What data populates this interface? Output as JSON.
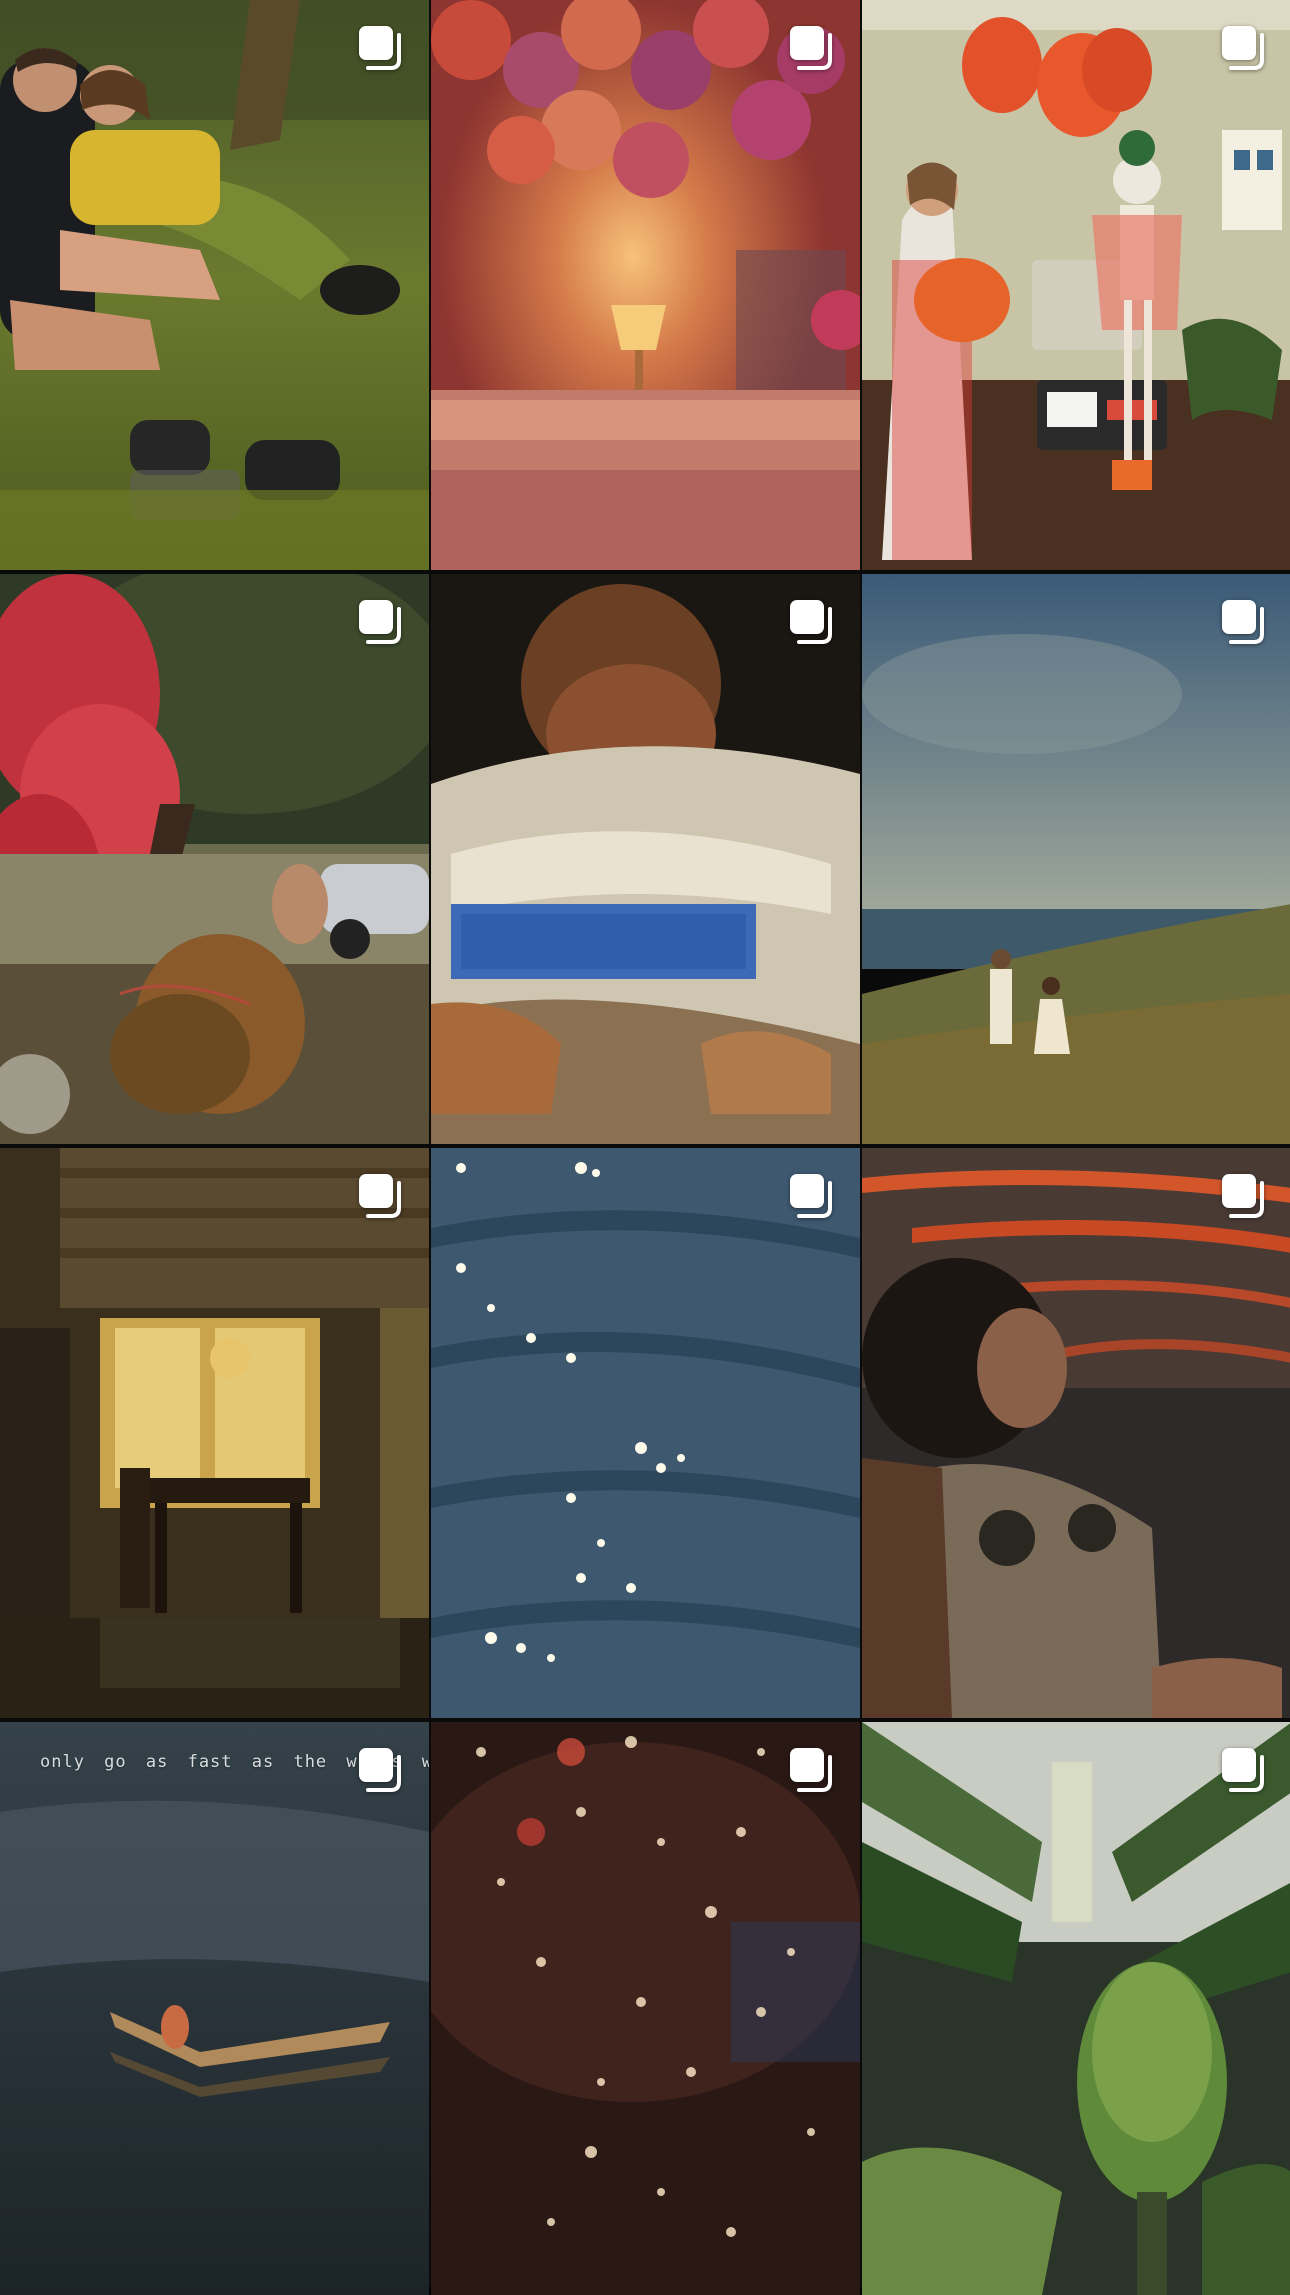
{
  "grid": {
    "columns": 3,
    "tiles": [
      {
        "subject": "couple-forest",
        "multi_photo": true
      },
      {
        "subject": "balloons-lamp-room",
        "multi_photo": true
      },
      {
        "subject": "halloween-skeleton",
        "multi_photo": true
      },
      {
        "subject": "red-tree-garden",
        "multi_photo": true
      },
      {
        "subject": "light-shirt",
        "multi_photo": true
      },
      {
        "subject": "coast-couple",
        "multi_photo": true
      },
      {
        "subject": "dining-room",
        "multi_photo": true
      },
      {
        "subject": "sparkling-water",
        "multi_photo": true
      },
      {
        "subject": "sunset-towel",
        "multi_photo": true
      },
      {
        "subject": "canoe-lake",
        "multi_photo": true,
        "caption": "only go as fast as the winds will take y"
      },
      {
        "subject": "bokeh-lights",
        "multi_photo": true
      },
      {
        "subject": "banana-tree",
        "multi_photo": true
      }
    ]
  },
  "icon": "carousel-multi-photo-icon",
  "colors": {
    "icon": "#ffffff",
    "background": "#000000"
  }
}
